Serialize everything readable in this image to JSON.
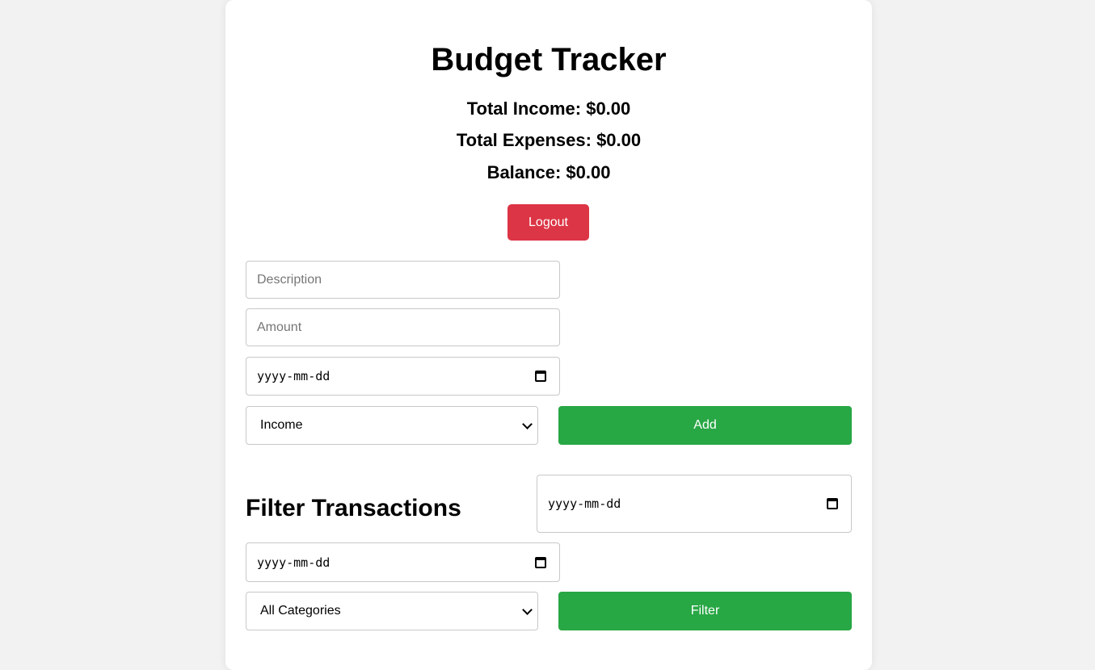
{
  "app": {
    "title": "Budget Tracker"
  },
  "summary": {
    "income": "Total Income: $0.00",
    "expenses": "Total Expenses: $0.00",
    "balance": "Balance: $0.00"
  },
  "logout": {
    "label": "Logout"
  },
  "add_form": {
    "description_placeholder": "Description",
    "amount_placeholder": "Amount",
    "date_placeholder": "yyyy-mm-dd",
    "type_selected": "Income",
    "add_label": "Add"
  },
  "filter": {
    "title": "Filter Transactions",
    "start_date_placeholder": "yyyy-mm-dd",
    "end_date_placeholder": "yyyy-mm-dd",
    "category_selected": "All Categories",
    "filter_label": "Filter"
  },
  "colors": {
    "background": "#f2f2f2",
    "card": "#ffffff",
    "danger": "#dc3545",
    "success": "#28a745"
  }
}
